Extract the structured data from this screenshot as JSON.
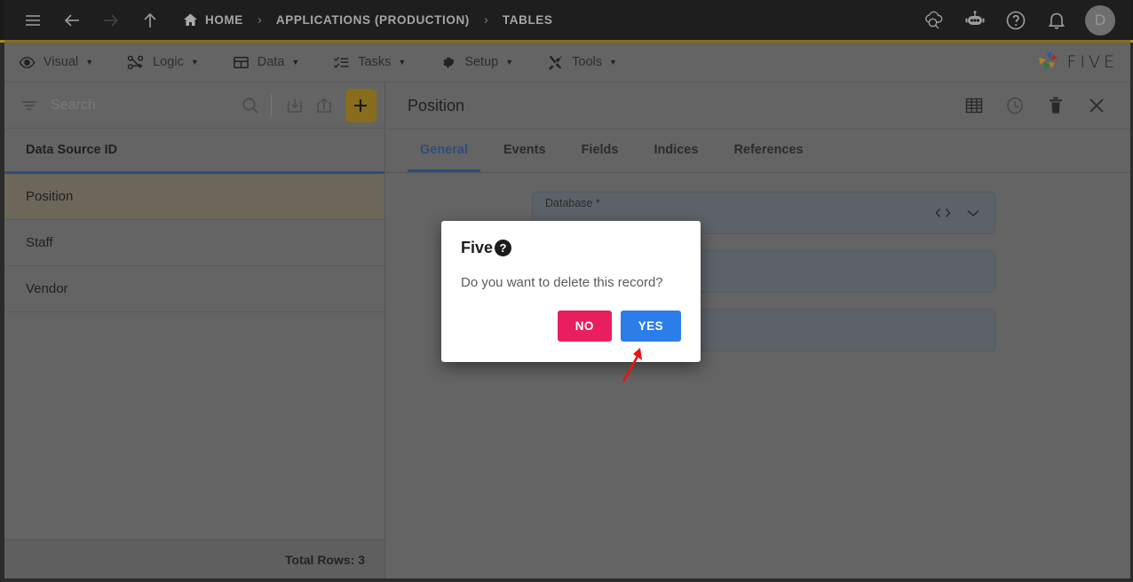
{
  "topbar": {
    "menu_icon": "hamburger-icon",
    "back_icon": "arrow-left-icon",
    "forward_icon": "arrow-right-icon",
    "up_icon": "arrow-up-icon",
    "breadcrumbs": [
      {
        "label": "HOME",
        "icon": "home-icon"
      },
      {
        "label": "APPLICATIONS (PRODUCTION)",
        "icon": ""
      },
      {
        "label": "TABLES",
        "icon": ""
      }
    ],
    "separator": "›",
    "actions": [
      {
        "name": "cloud-check-icon"
      },
      {
        "name": "robot-icon"
      },
      {
        "name": "help-icon"
      },
      {
        "name": "bell-icon"
      }
    ],
    "avatar_initial": "D"
  },
  "menubar": {
    "items": [
      {
        "label": "Visual",
        "icon": "eye-icon"
      },
      {
        "label": "Logic",
        "icon": "nodes-icon"
      },
      {
        "label": "Data",
        "icon": "table-icon"
      },
      {
        "label": "Tasks",
        "icon": "checklist-icon"
      },
      {
        "label": "Setup",
        "icon": "gear-icon"
      },
      {
        "label": "Tools",
        "icon": "tools-icon"
      }
    ],
    "caret": "▼",
    "brand_text": "FIVE"
  },
  "left_panel": {
    "search": {
      "placeholder": "Search",
      "value": ""
    },
    "filter_icon": "filter-icon",
    "search_icon": "search-icon",
    "import_icon": "import-icon",
    "export_icon": "export-icon",
    "add_label": "+",
    "column_header": "Data Source ID",
    "rows": [
      {
        "label": "Position",
        "selected": true
      },
      {
        "label": "Staff",
        "selected": false
      },
      {
        "label": "Vendor",
        "selected": false
      }
    ],
    "total_rows": "Total Rows: 3"
  },
  "right_panel": {
    "title": "Position",
    "actions": [
      {
        "name": "grid-icon"
      },
      {
        "name": "clock-icon"
      },
      {
        "name": "trash-icon"
      },
      {
        "name": "close-icon"
      }
    ],
    "tabs": [
      {
        "label": "General",
        "active": true
      },
      {
        "label": "Events",
        "active": false
      },
      {
        "label": "Fields",
        "active": false
      },
      {
        "label": "Indices",
        "active": false
      },
      {
        "label": "References",
        "active": false
      }
    ],
    "fields": [
      {
        "label": "Database *",
        "value": "",
        "code_icon": "code-icon",
        "dropdown_icon": "chevron-down-icon"
      },
      {
        "label": "",
        "value": ""
      },
      {
        "label": "",
        "value": ""
      }
    ]
  },
  "dialog": {
    "title": "Five",
    "title_icon": "question-mark-icon",
    "message": "Do you want to delete this record?",
    "buttons": [
      {
        "label": "NO",
        "color": "#e91e5e"
      },
      {
        "label": "YES",
        "color": "#2b7de9"
      }
    ]
  },
  "annotation": {
    "arrow_color": "#ee1111",
    "target": "yes-button"
  },
  "colors": {
    "accent_gold": "#b08b17",
    "accent_blue": "#2e5f9e",
    "topbar_bg": "#1a1a1a",
    "panel_bg": "#7f7f7f",
    "selected_row": "#8a8271",
    "btn_no": "#e91e5e",
    "btn_yes": "#2b7de9"
  }
}
